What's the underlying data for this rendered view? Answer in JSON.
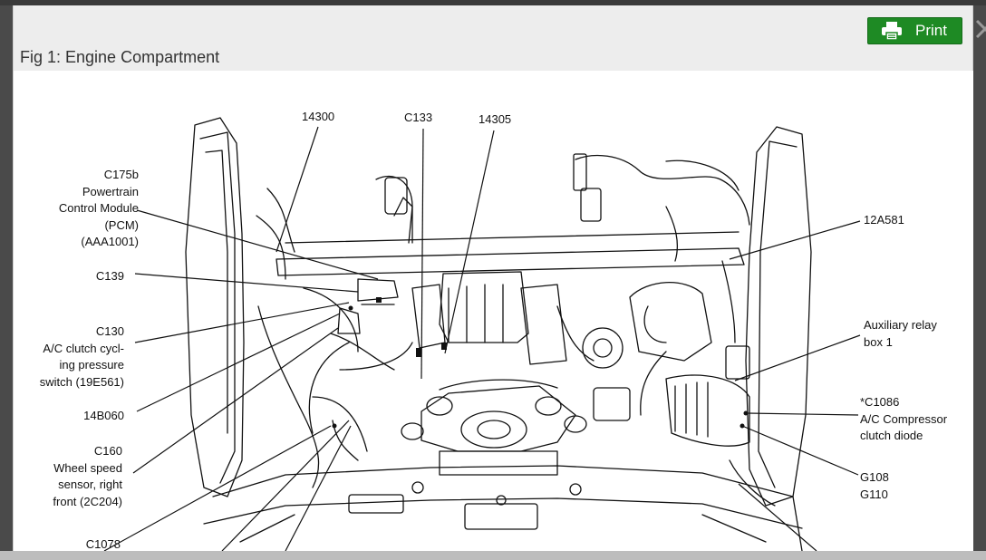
{
  "dialog": {
    "title": "Fig 1: Engine Compartment",
    "print_label": "Print",
    "print_color": "#1e8a24"
  },
  "callouts": {
    "c175b": "C175b\nPowertrain\nControl Module\n(PCM)\n(AAA1001)",
    "c139": "C139",
    "c130": "C130\nA/C clutch cycl-\ning pressure\nswitch (19E561)",
    "p14b060": "14B060",
    "c160": "C160\nWheel speed\nsensor, right\nfront (2C204)",
    "c1078": "C1078",
    "p14300": "14300",
    "c133": "C133",
    "p14305": "14305",
    "p12a581": "12A581",
    "aux_relay": "Auxiliary relay\nbox 1",
    "c1086": "*C1086\nA/C Compressor\nclutch diode",
    "g108": "G108\nG110"
  }
}
